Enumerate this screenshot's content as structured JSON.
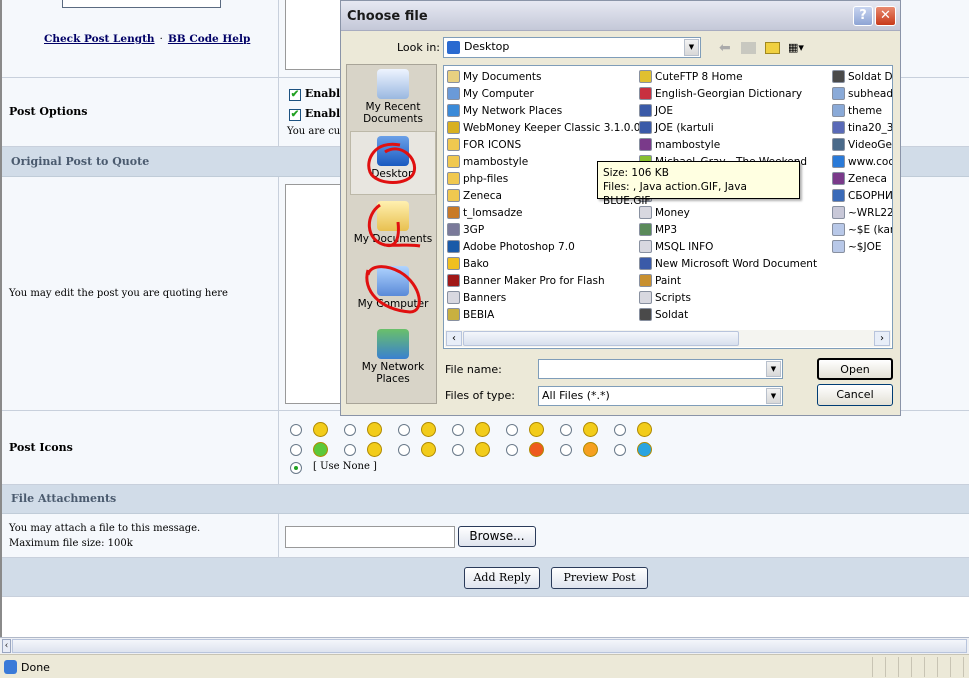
{
  "form": {
    "check_post_length": "Check Post Length",
    "separator": "·",
    "bb_code_help": "BB Code Help",
    "post_options_label": "Post Options",
    "options": [
      "Enabl",
      "Enabl"
    ],
    "options_note": "You are cu",
    "original_post_header": "Original Post to Quote",
    "quote_help": "You may edit the post you are quoting here",
    "post_icons_label": "Post Icons",
    "use_none": "[ Use None ]",
    "file_attachments_header": "File Attachments",
    "attach_line1": "You may attach a file to this message.",
    "attach_line2": "Maximum file size: 100k",
    "browse_button": "Browse...",
    "add_reply_button": "Add Reply",
    "preview_post_button": "Preview Post",
    "icon_colors": [
      "#f2cc1a",
      "#f2cc1a",
      "#f2cc1a",
      "#f2cc1a",
      "#f2cc1a",
      "#f2cc1a",
      "#f2cc1a",
      "#5cc83a",
      "#f2cc1a",
      "#f2cc1a",
      "#f2cc1a",
      "#ee5a1e",
      "#f5a020",
      "#2aa4e0"
    ],
    "icon_names": [
      "smile-icon",
      "frown-icon",
      "sleepy-icon",
      "grin-icon",
      "surprised-icon",
      "laugh-icon",
      "angry-icon",
      "sick-icon",
      "rolleyes-icon",
      "cool-icon",
      "arrow-icon",
      "heart-icon",
      "exclamation-icon",
      "question-icon"
    ]
  },
  "status_bar": {
    "text": "Done"
  },
  "dialog": {
    "title": "Choose file",
    "look_in_label": "Look in:",
    "look_in_value": "Desktop",
    "places": [
      "My Recent Documents",
      "Desktop",
      "My Documents",
      "My Computer",
      "My Network Places"
    ],
    "selected_place": "Desktop",
    "files": [
      [
        "My Documents",
        "My Computer",
        "My Network Places",
        "WebMoney Keeper Classic 3.1.0.0",
        "FOR ICONS",
        "mambostyle",
        "php-files",
        "Zeneca",
        "t_lomsadze",
        "3GP",
        "Adobe Photoshop 7.0",
        "Bako",
        "Banner Maker Pro for Flash",
        "Banners",
        "BEBIA"
      ],
      [
        "CuteFTP 8 Home",
        "English-Georgian Dictionary",
        "JOE",
        "JOE (kartuli",
        "mambostyle",
        "Michael_Gray - The Weekend",
        "",
        "Files",
        "Money",
        "MP3",
        "MSQL INFO",
        "New Microsoft Word Document",
        "Paint",
        "Scripts",
        "Soldat"
      ],
      [
        "Soldat De",
        "subheade",
        "theme",
        "tina20_3",
        "VideoGet",
        "www.coc",
        "Zeneca",
        "СБОРНИ",
        "~WRL22",
        "~$E (kar",
        "~$JOE"
      ]
    ],
    "file_icon_colors": [
      [
        "#e8d080",
        "#6a9ad8",
        "#3a8ad8",
        "#d8b020",
        "#f0c850",
        "#f0c850",
        "#f0c850",
        "#f0c850",
        "#c87a28",
        "#7a7a9a",
        "#1a5aa8",
        "#f0c020",
        "#a01818",
        "#d8d8e0",
        "#c8b040"
      ],
      [
        "#e0c030",
        "#c83040",
        "#3a5aa8",
        "#3a5aa8",
        "#7a3a8a",
        "#88c030",
        "#ffffff",
        "#d8d8e0",
        "#d8d8e0",
        "#5a8a5a",
        "#d8d8e0",
        "#3a5aa8",
        "#c89030",
        "#d8d8e0",
        "#4a4a4a"
      ],
      [
        "#4a4a4a",
        "#8aaad8",
        "#8aaad8",
        "#5a6ab8",
        "#4a6a8a",
        "#2a7ad8",
        "#7a3a8a",
        "#3a6ab8",
        "#c8c8d8",
        "#b8c8e8",
        "#b8c8e8"
      ]
    ],
    "tooltip": {
      "line1": "Size: 106 KB",
      "line2": "Files: , Java action.GIF, Java BLUE.GIF"
    },
    "file_name_label": "File name:",
    "file_name_value": "",
    "files_of_type_label": "Files of type:",
    "files_of_type_value": "All Files (*.*)",
    "open_button": "Open",
    "cancel_button": "Cancel",
    "help_button": "?",
    "close_button": "✕"
  },
  "annotation_color": "#e01010"
}
